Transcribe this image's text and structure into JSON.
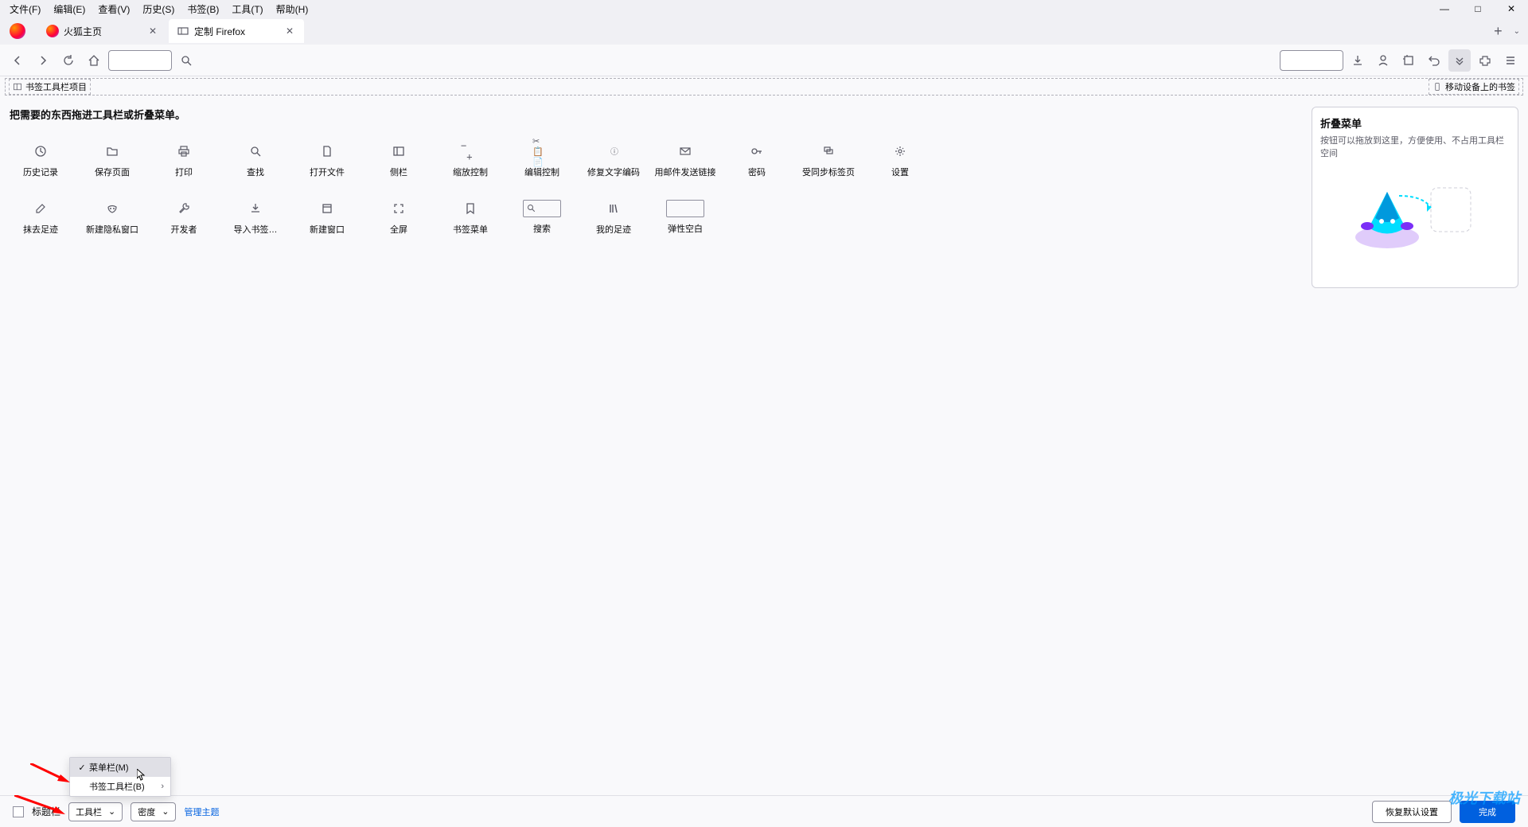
{
  "menubar": {
    "items": [
      "文件(F)",
      "编辑(E)",
      "查看(V)",
      "历史(S)",
      "书签(B)",
      "工具(T)",
      "帮助(H)"
    ]
  },
  "tabs": {
    "tab1": "火狐主页",
    "tab2": "定制 Firefox"
  },
  "bookmarks_bar": {
    "label": "书签工具栏项目",
    "mobile": "移动设备上的书签"
  },
  "customize": {
    "title": "把需要的东西拖进工具栏或折叠菜单。",
    "items_row1": [
      {
        "label": "历史记录",
        "icon": "clock-icon"
      },
      {
        "label": "保存页面",
        "icon": "folder-icon"
      },
      {
        "label": "打印",
        "icon": "print-icon"
      },
      {
        "label": "查找",
        "icon": "search-icon"
      },
      {
        "label": "打开文件",
        "icon": "file-icon"
      },
      {
        "label": "侧栏",
        "icon": "sidebar-icon"
      },
      {
        "label": "缩放控制",
        "icon": "zoom-icon"
      },
      {
        "label": "编辑控制",
        "icon": "edit-icon"
      },
      {
        "label": "修复文字编码",
        "icon": "encoding-icon"
      },
      {
        "label": "用邮件发送链接",
        "icon": "mail-icon"
      },
      {
        "label": "密码",
        "icon": "key-icon"
      },
      {
        "label": "受同步标签页",
        "icon": "sync-icon"
      },
      {
        "label": "设置",
        "icon": "gear-icon"
      }
    ],
    "items_row2": [
      {
        "label": "抹去足迹",
        "icon": "eraser-icon"
      },
      {
        "label": "新建隐私窗口",
        "icon": "mask-icon"
      },
      {
        "label": "开发者",
        "icon": "wrench-icon"
      },
      {
        "label": "导入书签…",
        "icon": "import-icon"
      },
      {
        "label": "新建窗口",
        "icon": "window-icon"
      },
      {
        "label": "全屏",
        "icon": "expand-icon"
      },
      {
        "label": "书签菜单",
        "icon": "bookmark-icon"
      },
      {
        "label": "搜索",
        "icon": "search-box"
      },
      {
        "label": "我的足迹",
        "icon": "library-icon"
      },
      {
        "label": "弹性空白",
        "icon": "spacer-box"
      }
    ]
  },
  "overflow": {
    "title": "折叠菜单",
    "desc": "按钮可以拖放到这里，方便使用、不占用工具栏空间"
  },
  "bottombar": {
    "titlebar": "标题栏",
    "toolbars": "工具栏",
    "density": "密度",
    "themes": "管理主题",
    "restore": "恢复默认设置",
    "done": "完成"
  },
  "context_menu": {
    "menubar": "菜单栏(M)",
    "bookmarks": "书签工具栏(B)"
  },
  "watermark": "极光下载站"
}
